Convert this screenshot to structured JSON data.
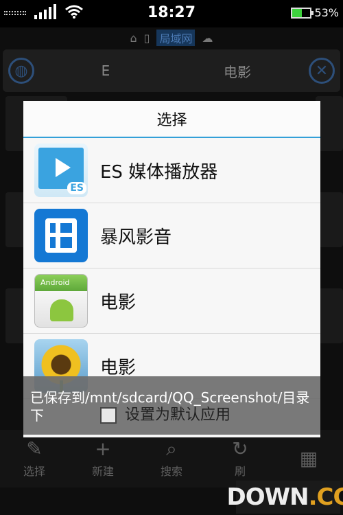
{
  "status_bar": {
    "time": "18:27",
    "battery": "53%",
    "battery_level": 0.53
  },
  "location_bar": {
    "label": "局域网"
  },
  "path_bar": {
    "segments": [
      "E",
      "电影"
    ]
  },
  "dialog": {
    "title": "选择",
    "apps": [
      {
        "label": "ES 媒体播放器",
        "icon": "es-media-player-icon",
        "badge": "ES"
      },
      {
        "label": "暴风影音",
        "icon": "baofeng-player-icon"
      },
      {
        "label": "电影",
        "icon": "android-app-icon",
        "icon_caption": "Android"
      },
      {
        "label": "电影",
        "icon": "sunflower-gallery-icon"
      }
    ],
    "set_default_label": "设置为默认应用"
  },
  "toast": {
    "message": "已保存到/mnt/sdcard/QQ_Screenshot/目录下"
  },
  "toolbar": {
    "items": [
      {
        "label": "选择",
        "icon": "select-icon"
      },
      {
        "label": "新建",
        "icon": "plus-icon"
      },
      {
        "label": "搜索",
        "icon": "search-icon"
      },
      {
        "label": "刷",
        "icon": "refresh-icon"
      }
    ]
  },
  "watermark": {
    "text": "DOWN",
    "suffix": ".CC"
  },
  "colors": {
    "accent": "#33a0d8",
    "battery": "#3dd23d",
    "dialog_bg": "#f7f7f7"
  }
}
